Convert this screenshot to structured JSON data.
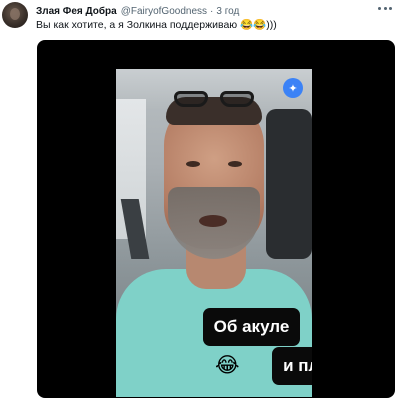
{
  "tweet": {
    "author_name": "Злая Фея Добра",
    "author_handle": "@FairyofGoodness",
    "separator": "·",
    "time": "3 год",
    "text": "Вы как хотите, а я Золкина поддерживаю 😂😂)))"
  },
  "media": {
    "sparkle_icon": "✦",
    "caption_line1": "Об акуле",
    "caption_line2": "и пловце",
    "emoji1": "😂",
    "emoji2": "😂"
  },
  "icons": {
    "avatar": "avatar",
    "more": "more-horizontal-icon",
    "sparkle": "sparkle-icon"
  }
}
